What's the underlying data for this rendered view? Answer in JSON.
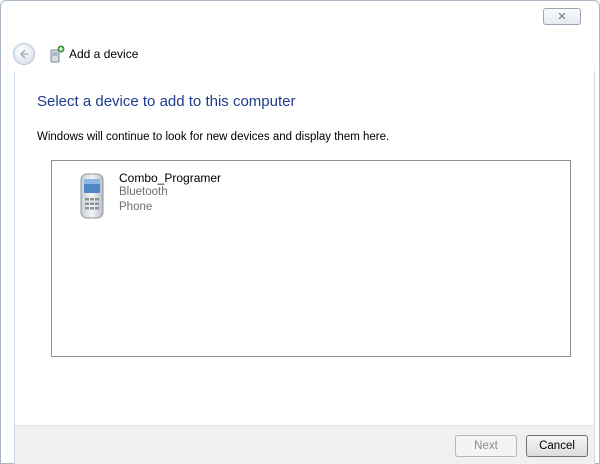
{
  "window": {
    "title": "Add a device",
    "close_symbol": "✕"
  },
  "page": {
    "heading": "Select a device to add to this computer",
    "description": "Windows will continue to look for new devices and display them here."
  },
  "devices": [
    {
      "name": "Combo_Programer",
      "connection": "Bluetooth",
      "type": "Phone",
      "icon": "mobile-phone-icon"
    }
  ],
  "footer": {
    "next_label": "Next",
    "cancel_label": "Cancel"
  },
  "colors": {
    "heading": "#1e3c8c",
    "subtext": "#6d6d6d",
    "footer_bg": "#f0f0f0"
  }
}
